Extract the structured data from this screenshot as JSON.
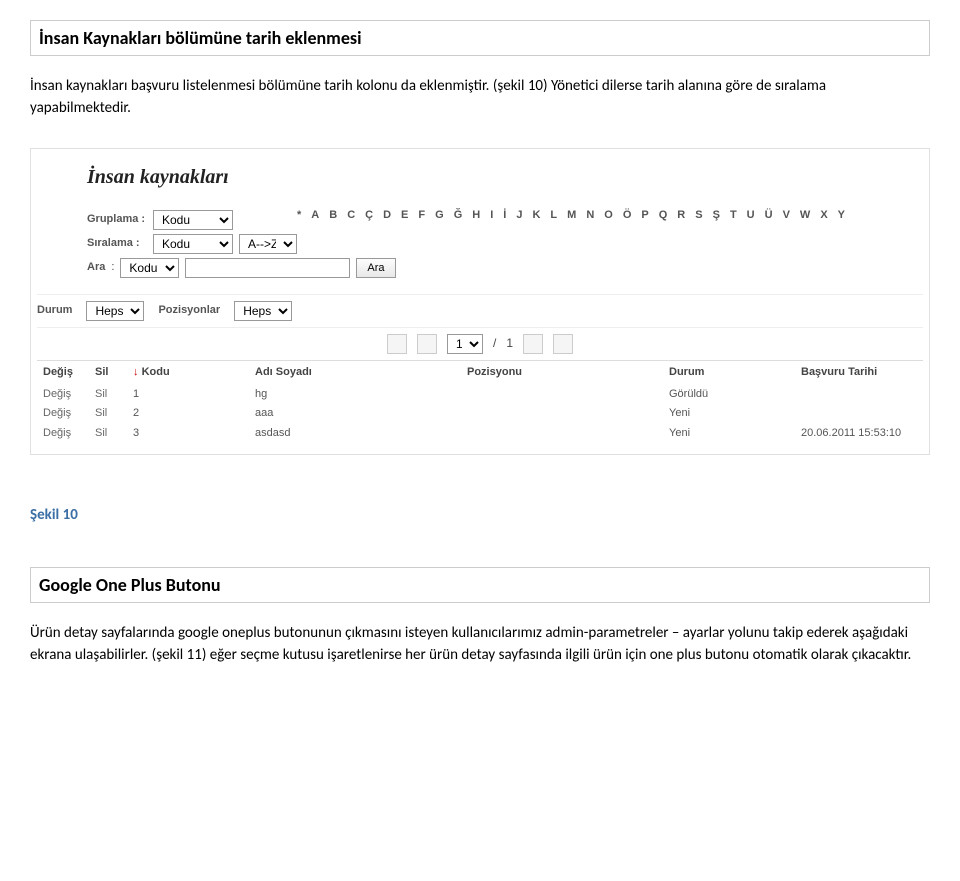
{
  "headings": {
    "section1": "İnsan Kaynakları bölümüne tarih eklenmesi",
    "section2": "Google One Plus Butonu"
  },
  "paragraphs": {
    "p1": "İnsan kaynakları başvuru listelenmesi  bölümüne tarih kolonu da eklenmiştir. (şekil 10)  Yönetici dilerse tarih alanına göre de sıralama yapabilmektedir.",
    "p2": "Ürün detay sayfalarında google oneplus butonunun çıkmasını isteyen kullanıcılarımız admin-parametreler – ayarlar yolunu takip ederek aşağıdaki ekrana ulaşabilirler. (şekil 11) eğer seçme kutusu işaretlenirse her ürün detay sayfasında ilgili ürün için one plus butonu otomatik olarak çıkacaktır.",
    "figlabel": "Şekil 10"
  },
  "screenshot": {
    "title": "İnsan kaynakları",
    "labels": {
      "gruplama": "Gruplama :",
      "siralama": "Sıralama  :",
      "ara": "Ara",
      "durum": "Durum",
      "pozisyonlar": "Pozisyonlar"
    },
    "selects": {
      "gruplama": "Kodu",
      "siralama": "Kodu",
      "sortdir": "A-->Z",
      "ara": "Kodu",
      "durum": "Hepsi",
      "pozisyonlar": "Hepsi"
    },
    "search_button": "Ara",
    "alpha": [
      "*",
      "A",
      "B",
      "C",
      "Ç",
      "D",
      "E",
      "F",
      "G",
      "Ğ",
      "H",
      "I",
      "İ",
      "J",
      "K",
      "L",
      "M",
      "N",
      "O",
      "Ö",
      "P",
      "Q",
      "R",
      "S",
      "Ş",
      "T",
      "U",
      "Ü",
      "V",
      "W",
      "X",
      "Y"
    ],
    "pager": {
      "page": "1",
      "sep": "/",
      "total": "1"
    },
    "columns": {
      "degis": "Değiş",
      "sil": "Sil",
      "kodu": "Kodu",
      "adsoyad": "Adı Soyadı",
      "pozisyon": "Pozisyonu",
      "durum": "Durum",
      "basvuru": "Başvuru Tarihi"
    },
    "rows": [
      {
        "degis": "Değiş",
        "sil": "Sil",
        "kodu": "1",
        "ad": "hg",
        "poz": "",
        "durum": "Görüldü",
        "tarih": ""
      },
      {
        "degis": "Değiş",
        "sil": "Sil",
        "kodu": "2",
        "ad": "aaa",
        "poz": "",
        "durum": "Yeni",
        "tarih": ""
      },
      {
        "degis": "Değiş",
        "sil": "Sil",
        "kodu": "3",
        "ad": "asdasd",
        "poz": "",
        "durum": "Yeni",
        "tarih": "20.06.2011 15:53:10"
      }
    ]
  }
}
